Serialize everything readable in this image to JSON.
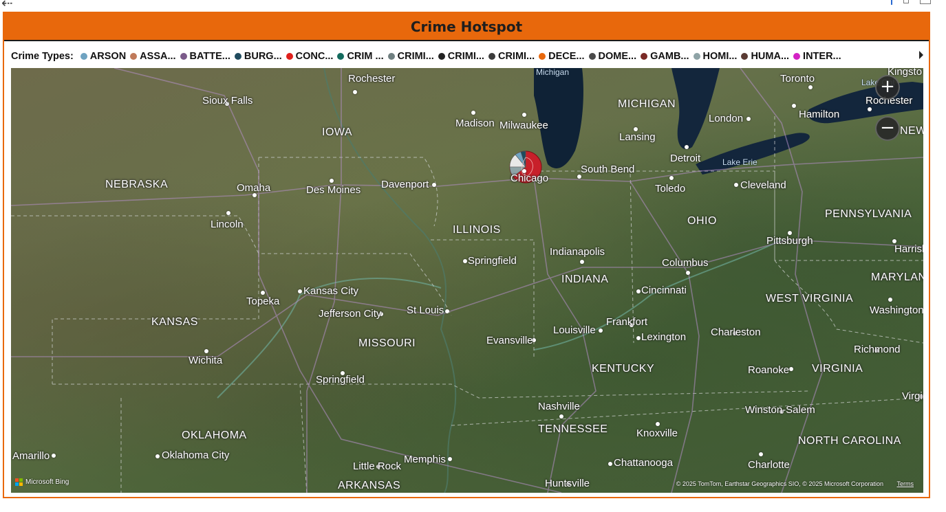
{
  "visual": {
    "title": "Crime Hotspot"
  },
  "legend": {
    "title": "Crime Types:",
    "items": [
      {
        "label": "ARSON",
        "color": "#6fa3c1"
      },
      {
        "label": "ASSA...",
        "color": "#c07a5a"
      },
      {
        "label": "BATTE...",
        "color": "#7b5a8a"
      },
      {
        "label": "BURG...",
        "color": "#1f4b5e"
      },
      {
        "label": "CONC...",
        "color": "#e0201c"
      },
      {
        "label": "CRIM ...",
        "color": "#136b5e"
      },
      {
        "label": "CRIMI...",
        "color": "#6f7f80"
      },
      {
        "label": "CRIMI...",
        "color": "#222222"
      },
      {
        "label": "CRIMI...",
        "color": "#3b3b3b"
      },
      {
        "label": "DECE...",
        "color": "#e8680c"
      },
      {
        "label": "DOME...",
        "color": "#4a4a4a"
      },
      {
        "label": "GAMB...",
        "color": "#7a2a26"
      },
      {
        "label": "HOMI...",
        "color": "#8ea3a6"
      },
      {
        "label": "HUMA...",
        "color": "#5a3b33"
      },
      {
        "label": "INTER...",
        "color": "#d322c4"
      }
    ]
  },
  "map": {
    "states": [
      {
        "name": "NEBRASKA"
      },
      {
        "name": "IOWA"
      },
      {
        "name": "ILLINOIS"
      },
      {
        "name": "INDIANA"
      },
      {
        "name": "OHIO"
      },
      {
        "name": "MICHIGAN"
      },
      {
        "name": "PENNSYLVANIA"
      },
      {
        "name": "KANSAS"
      },
      {
        "name": "MISSOURI"
      },
      {
        "name": "KENTUCKY"
      },
      {
        "name": "WEST VIRGINIA"
      },
      {
        "name": "VIRGINIA"
      },
      {
        "name": "TENNESSEE"
      },
      {
        "name": "NORTH CAROLINA"
      },
      {
        "name": "OKLAHOMA"
      },
      {
        "name": "ARKANSAS"
      },
      {
        "name": "MARYLAN"
      },
      {
        "name": "NEW Y"
      }
    ],
    "cities": [
      {
        "name": "Rochester"
      },
      {
        "name": "Sioux Falls"
      },
      {
        "name": "Madison"
      },
      {
        "name": "Milwaukee"
      },
      {
        "name": "Toronto"
      },
      {
        "name": "Rochester"
      },
      {
        "name": "Hamilton"
      },
      {
        "name": "London"
      },
      {
        "name": "Lansing"
      },
      {
        "name": "Detroit"
      },
      {
        "name": "South Bend"
      },
      {
        "name": "Toledo"
      },
      {
        "name": "Cleveland"
      },
      {
        "name": "Chicago"
      },
      {
        "name": "Omaha"
      },
      {
        "name": "Des Moines"
      },
      {
        "name": "Davenport"
      },
      {
        "name": "Lincoln"
      },
      {
        "name": "Pittsburgh"
      },
      {
        "name": "Harrisburg"
      },
      {
        "name": "Springfield"
      },
      {
        "name": "Indianapolis"
      },
      {
        "name": "Columbus"
      },
      {
        "name": "Cincinnati"
      },
      {
        "name": "Kansas City"
      },
      {
        "name": "Topeka"
      },
      {
        "name": "Jefferson City"
      },
      {
        "name": "St Louis"
      },
      {
        "name": "Washington"
      },
      {
        "name": "Frankfort"
      },
      {
        "name": "Louisville"
      },
      {
        "name": "Lexington"
      },
      {
        "name": "Charleston"
      },
      {
        "name": "Evansville"
      },
      {
        "name": "Wichita"
      },
      {
        "name": "Springfield"
      },
      {
        "name": "Richmond"
      },
      {
        "name": "Roanoke"
      },
      {
        "name": "Nashville"
      },
      {
        "name": "Knoxville"
      },
      {
        "name": "Winston-Salem"
      },
      {
        "name": "Virgini"
      },
      {
        "name": "Amarillo"
      },
      {
        "name": "Oklahoma City"
      },
      {
        "name": "Little Rock"
      },
      {
        "name": "Memphis"
      },
      {
        "name": "Chattanooga"
      },
      {
        "name": "Charlotte"
      },
      {
        "name": "Huntsville"
      },
      {
        "name": "Kingsto"
      }
    ],
    "waters": [
      {
        "name": "Michigan"
      },
      {
        "name": "Lake Erie"
      },
      {
        "name": "Lake Ont"
      }
    ],
    "hotspot_colors": [
      "#c8202a",
      "#e0201c",
      "#6fa3c1",
      "#c07a5a",
      "#7b5a8a",
      "#1f4b5e",
      "#136b5e",
      "#e8680c"
    ],
    "zoom_in": "+",
    "zoom_out": "−",
    "bing_label": "Microsoft Bing",
    "copyright": "© 2025 TomTom, Earthstar Geographics SIO, © 2025 Microsoft Corporation",
    "terms": "Terms"
  }
}
